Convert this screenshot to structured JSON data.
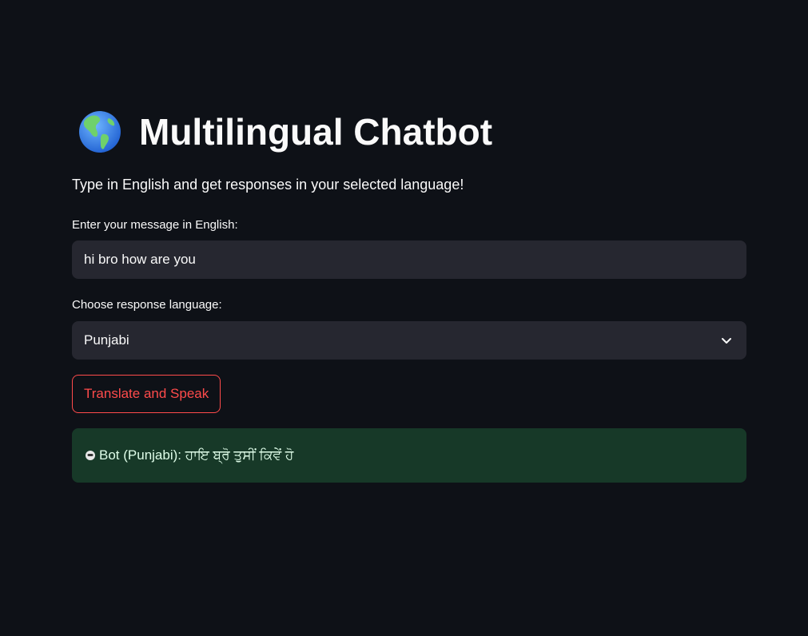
{
  "header": {
    "globe_icon": "globe-americas-icon",
    "title": "Multilingual Chatbot",
    "subtitle": "Type in English and get responses in your selected language!"
  },
  "message_input": {
    "label": "Enter your message in English:",
    "value": "hi bro how are you"
  },
  "language_select": {
    "label": "Choose response language:",
    "selected": "Punjabi",
    "icon": "chevron-down-icon"
  },
  "translate_button": {
    "label": "Translate and Speak"
  },
  "response": {
    "icon": "bot-face-icon",
    "text": "Bot (Punjabi): ਹਾਇ ਬ੍ਰੋ ਤੁਸੀਂ ਕਿਵੇਂ ਹੋ"
  },
  "colors": {
    "background": "#0e1117",
    "input_bg": "#262730",
    "accent": "#ff4b4b",
    "success_bg": "#173928",
    "success_text": "#dffde9"
  }
}
